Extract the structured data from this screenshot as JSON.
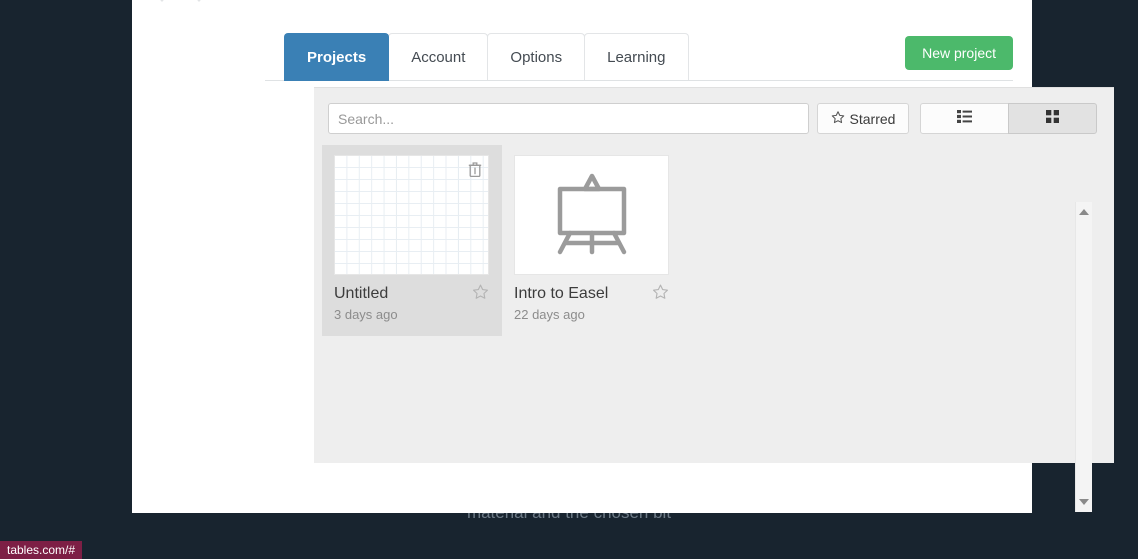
{
  "background": {
    "text_behind_modal": "material and the chosen bit",
    "overlay_color": "#18242f"
  },
  "modal": {
    "tabs": [
      {
        "label": "Projects",
        "active": true
      },
      {
        "label": "Account",
        "active": false
      },
      {
        "label": "Options",
        "active": false
      },
      {
        "label": "Learning",
        "active": false
      }
    ],
    "new_project_button": "New project",
    "toolbar": {
      "search_placeholder": "Search...",
      "search_value": "",
      "starred_label": "Starred",
      "star_icon": "star-outline-icon",
      "list_view_icon": "list-view-icon",
      "grid_view_icon": "grid-view-icon",
      "active_view": "grid"
    },
    "projects": [
      {
        "title": "Untitled",
        "date": "3 days ago",
        "thumbnail": "blueprint-grid",
        "hovered": true,
        "starred": false,
        "delete_icon": "trash-icon"
      },
      {
        "title": "Intro to Easel",
        "date": "22 days ago",
        "thumbnail": "easel-icon",
        "hovered": false,
        "starred": false,
        "delete_icon": null
      }
    ]
  },
  "status_bar": {
    "link_preview": "tables.com/#",
    "background_color": "#7d1f45"
  },
  "colors": {
    "active_tab": "#3a80b5",
    "new_project_green": "#4cb96b",
    "panel_bg": "#eeeeee",
    "card_hover_bg": "#dddddd"
  }
}
